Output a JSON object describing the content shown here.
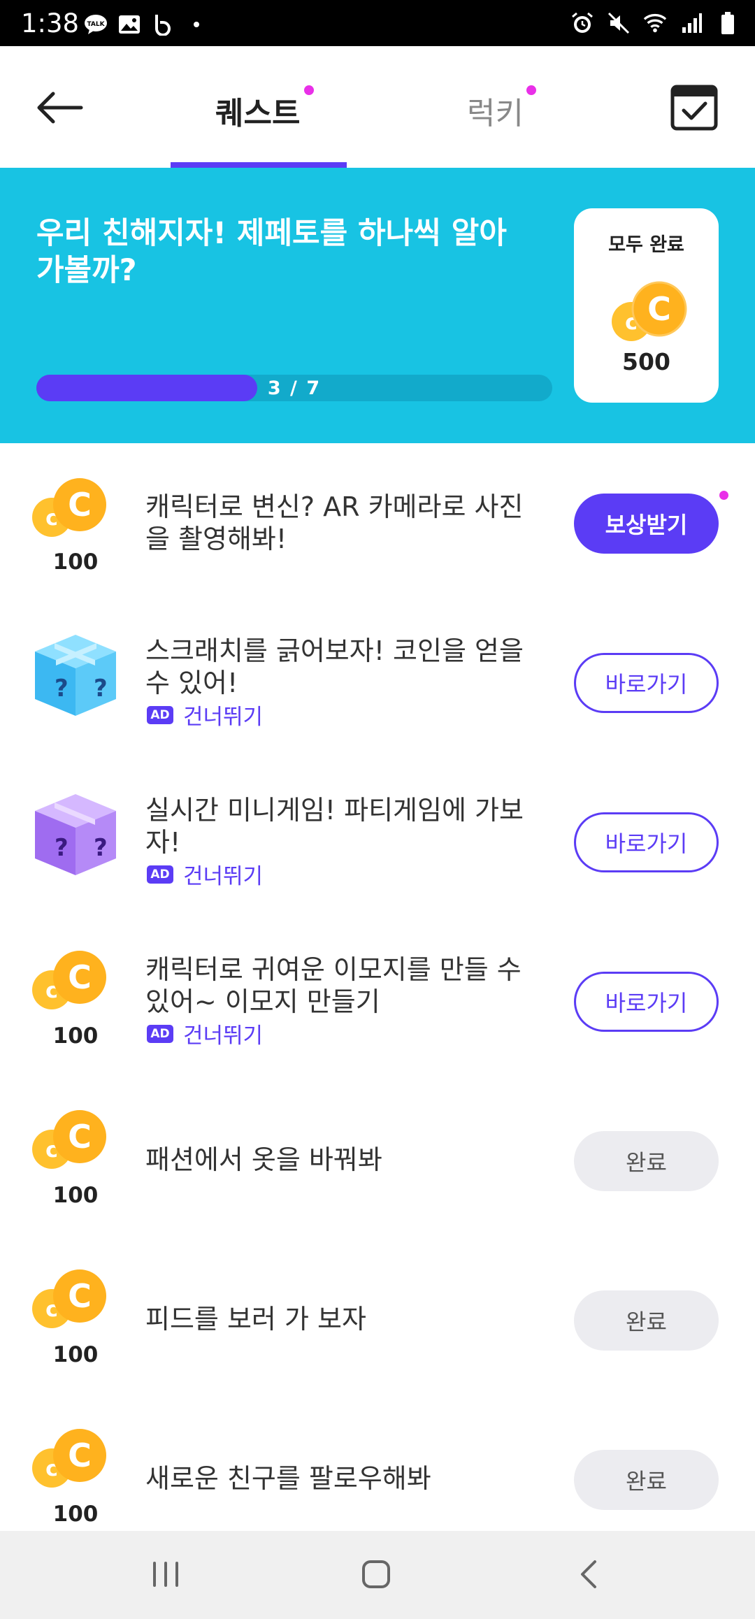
{
  "status_bar": {
    "time": "1:38",
    "left_icons": [
      "kakaotalk-icon",
      "gallery-icon",
      "band-icon",
      "dot-icon"
    ],
    "right_icons": [
      "alarm-icon",
      "mute-icon",
      "wifi-icon",
      "signal-icon",
      "battery-icon"
    ]
  },
  "header": {
    "back_icon": "back-arrow-icon",
    "tabs": [
      {
        "label": "퀘스트",
        "active": true,
        "has_dot": true
      },
      {
        "label": "럭키",
        "active": false,
        "has_dot": true
      }
    ],
    "calendar_icon": "calendar-check-icon"
  },
  "banner": {
    "title": "우리 친해지자! 제페토를 하나씩 알아가볼까?",
    "progress_current": 3,
    "progress_total": 7,
    "progress_text": "3 / 7",
    "reward_label": "모두 완료",
    "reward_amount": "500"
  },
  "quests": [
    {
      "icon": "coin-icon",
      "amount": "100",
      "title": "캐릭터로 변신? AR 카메라로 사진을 촬영해봐!",
      "button": "보상받기",
      "button_type": "reward",
      "has_dot": true,
      "ad_skip": false
    },
    {
      "icon": "blue-mystery-box-icon",
      "amount": "",
      "title": "스크래치를 긁어보자! 코인을 얻을 수 있어!",
      "button": "바로가기",
      "button_type": "go",
      "ad_skip": true,
      "ad_label": "AD",
      "skip_label": "건너뛰기"
    },
    {
      "icon": "purple-mystery-box-icon",
      "amount": "",
      "title": "실시간 미니게임! 파티게임에 가보자!",
      "button": "바로가기",
      "button_type": "go",
      "ad_skip": true,
      "ad_label": "AD",
      "skip_label": "건너뛰기"
    },
    {
      "icon": "coin-icon",
      "amount": "100",
      "title": "캐릭터로 귀여운 이모지를 만들 수 있어~ 이모지 만들기",
      "button": "바로가기",
      "button_type": "go",
      "ad_skip": true,
      "ad_label": "AD",
      "skip_label": "건너뛰기"
    },
    {
      "icon": "coin-icon",
      "amount": "100",
      "title": "패션에서 옷을 바꿔봐",
      "button": "완료",
      "button_type": "done",
      "ad_skip": false
    },
    {
      "icon": "coin-icon",
      "amount": "100",
      "title": "피드를 보러 가 보자",
      "button": "완료",
      "button_type": "done",
      "ad_skip": false
    },
    {
      "icon": "coin-icon",
      "amount": "100",
      "title": "새로운 친구를 팔로우해봐",
      "button": "완료",
      "button_type": "done",
      "ad_skip": false
    }
  ],
  "colors": {
    "accent": "#5b3cf5",
    "banner": "#18c3e3",
    "notification_dot": "#e930e8",
    "coin": "#ffb21e"
  },
  "nav_bar": {
    "buttons": [
      "recent-apps-icon",
      "home-icon",
      "back-icon"
    ]
  }
}
